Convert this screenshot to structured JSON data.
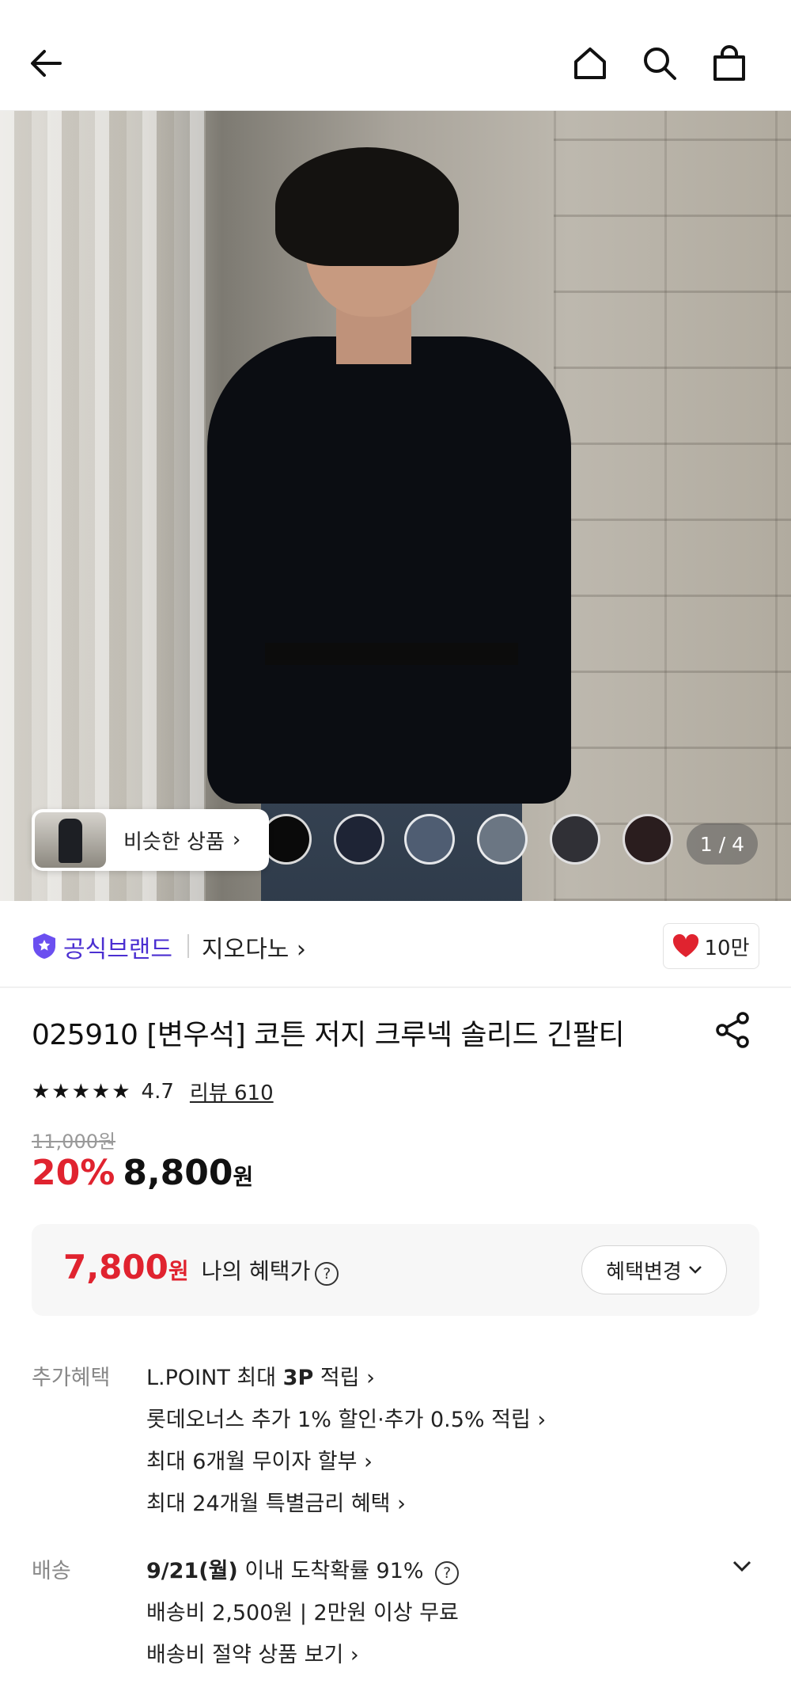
{
  "header": {
    "back_icon": "back-arrow-icon",
    "home_icon": "home-icon",
    "search_icon": "search-icon",
    "cart_icon": "shopping-bag-icon"
  },
  "gallery": {
    "similar_label": "비슷한 상품",
    "similar_chevron": "›",
    "counter": "1 / 4",
    "swatches": [
      "#0a0a0a",
      "#1e2435",
      "#4f5d72",
      "#6b7683",
      "#303036",
      "#2a1d1e"
    ]
  },
  "brand": {
    "official_label": "공식브랜드",
    "name": "지오다노 ›",
    "like_count": "10만",
    "accent": "#4b2fd1"
  },
  "product": {
    "title": "025910 [변우석] 코튼 저지 크루넥 솔리드 긴팔티",
    "stars": "★★★★★",
    "rating": "4.7",
    "review_link": "리뷰 610",
    "original_price": "11,000원",
    "discount": "20%",
    "sale_price": "8,800",
    "sale_unit": "원"
  },
  "benefit": {
    "price": "7,800",
    "unit": "원",
    "label": "나의 혜택가",
    "help": "?",
    "change_button": "혜택변경"
  },
  "extra": {
    "label": "추가혜택",
    "line1_pre": "L.POINT 최대 ",
    "line1_bold": "3P",
    "line1_post": " 적립 ›",
    "line2": "롯데오너스 추가 1% 할인·추가 0.5% 적립 ›",
    "line3": "최대 6개월 무이자 할부 ›",
    "line4": "최대 24개월 특별금리 혜택 ›"
  },
  "shipping": {
    "label": "배송",
    "date_bold": "9/21(월)",
    "date_post": " 이내 도착확률 91%",
    "help": "?",
    "fee": "배송비 2,500원 | 2만원 이상 무료",
    "saving_link": "배송비 절약 상품 보기 ›"
  },
  "colors": {
    "sale_red": "#e0232f",
    "brand_purple": "#4b2fd1"
  }
}
